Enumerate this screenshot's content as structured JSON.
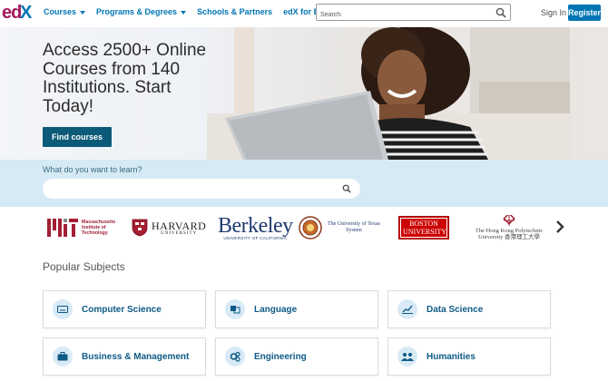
{
  "header": {
    "logo_text": "edX",
    "nav": [
      {
        "label": "Courses",
        "has_caret": true
      },
      {
        "label": "Programs & Degrees",
        "has_caret": true
      },
      {
        "label": "Schools & Partners",
        "has_caret": false
      },
      {
        "label": "edX for Business",
        "has_caret": false
      }
    ],
    "search_placeholder": "Search:",
    "signin_label": "Sign In",
    "register_label": "Register"
  },
  "hero": {
    "title": "Access 2500+ Online Courses from 140 Institutions. Start Today!",
    "button_label": "Find courses"
  },
  "learn_search": {
    "label": "What do you want to learn?",
    "placeholder": ""
  },
  "partners": {
    "mit": "Massachusetts Institute of Technology",
    "harvard_name": "HARVARD",
    "harvard_sub": "UNIVERSITY",
    "berkeley_name": "Berkeley",
    "berkeley_sub": "UNIVERSITY OF CALIFORNIA",
    "ut": "The University of Texas System",
    "bu": "BOSTON UNIVERSITY",
    "hk": "The Hong Kong Polytechnic University 香港理工大學"
  },
  "subjects": {
    "title": "Popular Subjects",
    "items": [
      {
        "label": "Computer Science",
        "icon": "keyboard-icon"
      },
      {
        "label": "Language",
        "icon": "language-icon"
      },
      {
        "label": "Data Science",
        "icon": "chart-icon"
      },
      {
        "label": "Business & Management",
        "icon": "briefcase-icon"
      },
      {
        "label": "Engineering",
        "icon": "gears-icon"
      },
      {
        "label": "Humanities",
        "icon": "people-icon"
      }
    ]
  },
  "colors": {
    "brand_blue": "#0075b4",
    "button_dark": "#0b5a78",
    "band_bg": "#d5eaf4",
    "edx_magenta": "#a3195b"
  }
}
